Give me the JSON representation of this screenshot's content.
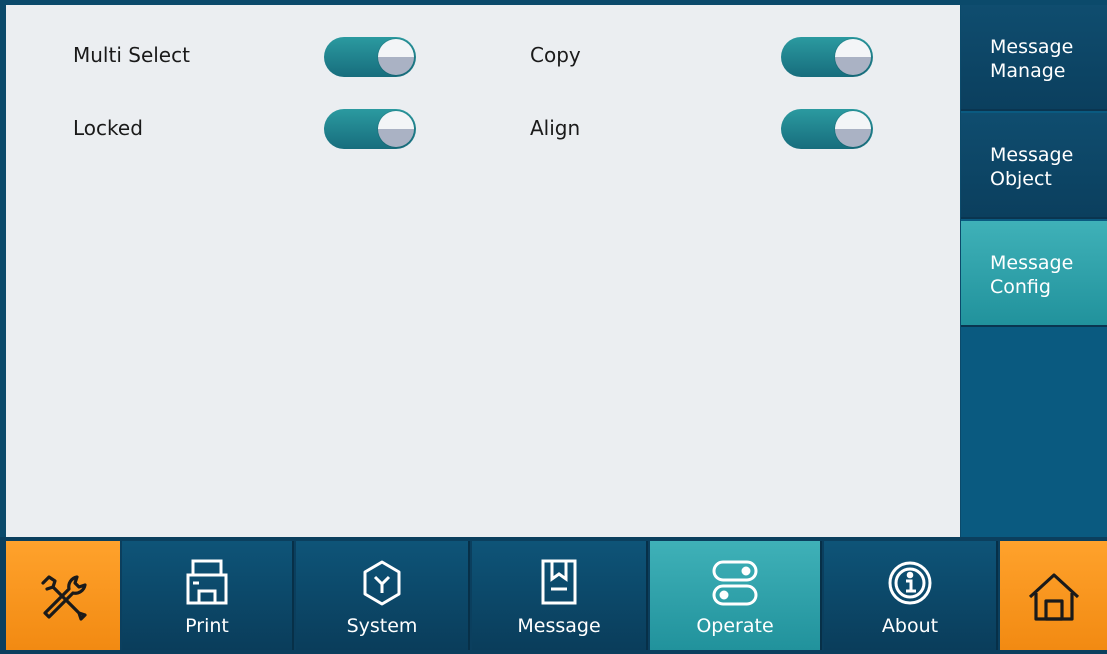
{
  "options": [
    {
      "label": "Multi Select",
      "state": "on"
    },
    {
      "label": "Copy",
      "state": "on"
    },
    {
      "label": "Locked",
      "state": "on"
    },
    {
      "label": "Align",
      "state": "on"
    }
  ],
  "side_tabs": [
    {
      "label": "Message\nManage",
      "active": false
    },
    {
      "label": "Message\nObject",
      "active": false
    },
    {
      "label": "Message\nConfig",
      "active": true
    }
  ],
  "bottom_nav": {
    "tools_icon": "tools-icon",
    "items": [
      {
        "label": "Print",
        "icon": "printer-icon",
        "active": false
      },
      {
        "label": "System",
        "icon": "system-icon",
        "active": false
      },
      {
        "label": "Message",
        "icon": "message-icon",
        "active": false
      },
      {
        "label": "Operate",
        "icon": "operate-icon",
        "active": true
      },
      {
        "label": "About",
        "icon": "info-icon",
        "active": false
      }
    ],
    "home_icon": "home-icon"
  },
  "colors": {
    "accent_teal": "#2b9aa0",
    "nav_blue": "#0b3f5e",
    "orange": "#f7941d",
    "content_bg": "#ebeef1"
  }
}
